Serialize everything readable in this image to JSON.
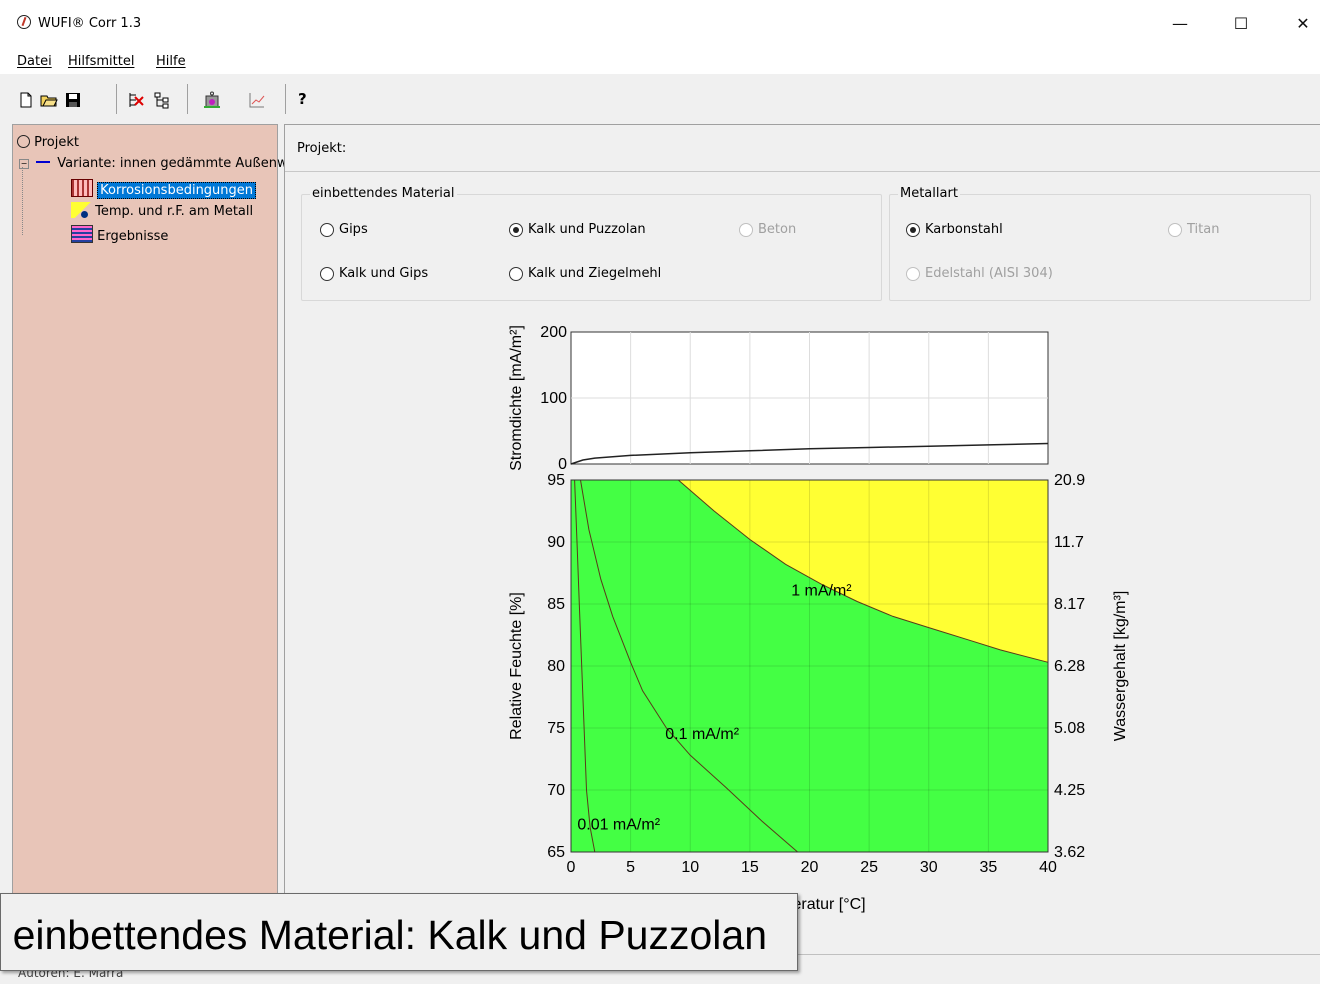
{
  "window": {
    "title": "WUFI® Corr 1.3",
    "minimize": "—",
    "maximize": "☐",
    "close": "✕"
  },
  "menu": {
    "items": [
      "Datei",
      "Hilfsmittel",
      "Hilfe"
    ]
  },
  "toolbar": {
    "help_label": "?",
    "icons": [
      "new-file-icon",
      "open-folder-icon",
      "save-icon",
      "delete-variant-icon",
      "tree-structure-icon",
      "calculation-icon",
      "chart-icon",
      "help-icon"
    ]
  },
  "tree": {
    "root": "Projekt",
    "variant": "Variante: innen gedämmte Außenwand",
    "children": [
      "Korrosionsbedingungen",
      "Temp. und r.F. am Metall",
      "Ergebnisse"
    ]
  },
  "main": {
    "project_label": "Projekt:",
    "material_group": {
      "title": "einbettendes Material",
      "options": [
        {
          "label": "Gips",
          "checked": false,
          "enabled": true
        },
        {
          "label": "Kalk und Puzzolan",
          "checked": true,
          "enabled": true
        },
        {
          "label": "Beton",
          "checked": false,
          "enabled": false
        },
        {
          "label": "Kalk und Gips",
          "checked": false,
          "enabled": true
        },
        {
          "label": "Kalk und Ziegelmehl",
          "checked": false,
          "enabled": true
        }
      ]
    },
    "metal_group": {
      "title": "Metallart",
      "options": [
        {
          "label": "Karbonstahl",
          "checked": true,
          "enabled": true
        },
        {
          "label": "Titan",
          "checked": false,
          "enabled": false
        },
        {
          "label": "Edelstahl (AISI 304)",
          "checked": false,
          "enabled": false
        }
      ]
    }
  },
  "chart_data": [
    {
      "type": "line",
      "ylabel": "Stromdichte [mA/m²]",
      "ylim": [
        0,
        200
      ],
      "yticks": [
        "200",
        "100",
        "0"
      ],
      "xlim": [
        0,
        40
      ],
      "grid": true,
      "series": [
        {
          "x": [
            0,
            1,
            2,
            5,
            10,
            15,
            20,
            25,
            30,
            35,
            40
          ],
          "values": [
            0,
            6,
            9,
            13,
            17,
            20,
            23,
            25,
            27,
            29,
            31
          ]
        }
      ],
      "colors": {
        "line": "#222222"
      }
    },
    {
      "type": "heatmap",
      "xlabel": "Temperatur [°C]",
      "ylabel": "Relative Feuchte [%]",
      "y2label": "Wassergehalt [kg/m³]",
      "xlim": [
        0,
        40
      ],
      "ylim": [
        65,
        95
      ],
      "xticks": [
        "0",
        "5",
        "10",
        "15",
        "20",
        "25",
        "30",
        "35",
        "40"
      ],
      "yticks": [
        "95",
        "90",
        "85",
        "80",
        "75",
        "70",
        "65"
      ],
      "y2ticks": [
        "20.9",
        "11.7",
        "8.17",
        "6.28",
        "5.08",
        "4.25",
        "3.62"
      ],
      "colors": {
        "low": "#44ff44",
        "high": "#ffff33"
      },
      "contours": [
        {
          "label": "1 mA/m²",
          "x": [
            9,
            12,
            15,
            18,
            21,
            24,
            27,
            30,
            33,
            36,
            40
          ],
          "y": [
            95,
            92.5,
            90.2,
            88.2,
            86.6,
            85.2,
            84,
            83.1,
            82.2,
            81.3,
            80.3
          ]
        },
        {
          "label": "0.1 mA/m²",
          "x": [
            0.8,
            1.5,
            2.5,
            3.5,
            5,
            6,
            8,
            10,
            13,
            16,
            19
          ],
          "y": [
            95,
            91,
            87,
            84,
            80.3,
            78,
            75,
            72.8,
            70.2,
            67.5,
            65
          ]
        },
        {
          "label": "0.01 mA/m²",
          "x": [
            0.3,
            0.5,
            0.7,
            0.9,
            1.1,
            1.3,
            1.6,
            2
          ],
          "y": [
            95,
            90,
            85,
            80,
            75,
            70,
            67,
            65
          ]
        }
      ]
    }
  ],
  "tooltip": {
    "text": "einbettendes Material: Kalk und Puzzolan"
  },
  "statusbar": {
    "text": "Autoren: E. Marra"
  }
}
